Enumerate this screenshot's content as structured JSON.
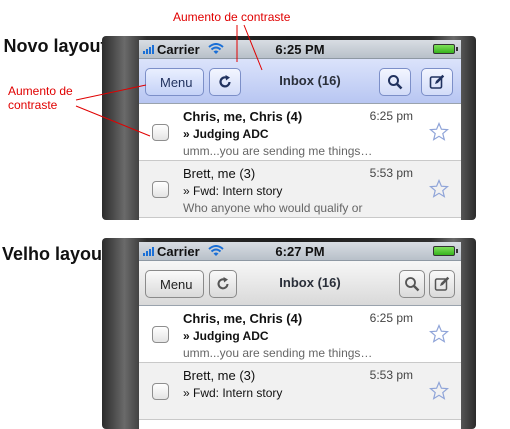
{
  "annotations": {
    "top": "Aumento de contraste",
    "left": "Aumento de contraste"
  },
  "labels": {
    "new": "Novo layout",
    "old": "Velho layout"
  },
  "colors": {
    "annotation": "#e00000",
    "new_toolbar": "#c7d3f6",
    "old_toolbar": "#e2e2e2"
  },
  "new_layout": {
    "status": {
      "carrier": "Carrier",
      "time": "6:25 PM"
    },
    "toolbar": {
      "menu_label": "Menu",
      "title": "Inbox (16)",
      "icons": [
        "refresh-icon",
        "search-icon",
        "compose-icon"
      ]
    },
    "messages": [
      {
        "sender": "Chris, me, Chris (4)",
        "time": "6:25 pm",
        "subject": "» Judging ADC",
        "snippet": "umm...you are sending me things…",
        "unread": true
      },
      {
        "sender": "Brett, me (3)",
        "time": "5:53 pm",
        "subject": "» Fwd: Intern story",
        "snippet": "Who anyone who would qualify or",
        "unread": false
      }
    ]
  },
  "old_layout": {
    "status": {
      "carrier": "Carrier",
      "time": "6:27 PM"
    },
    "toolbar": {
      "menu_label": "Menu",
      "title": "Inbox (16)",
      "icons": [
        "refresh-icon",
        "search-icon",
        "compose-icon"
      ]
    },
    "messages": [
      {
        "sender": "Chris, me, Chris (4)",
        "time": "6:25 pm",
        "subject": "» Judging ADC",
        "snippet": "umm...you are sending me things…",
        "unread": true
      },
      {
        "sender": "Brett, me (3)",
        "time": "5:53 pm",
        "subject": "» Fwd: Intern story",
        "snippet": "",
        "unread": false
      }
    ]
  }
}
